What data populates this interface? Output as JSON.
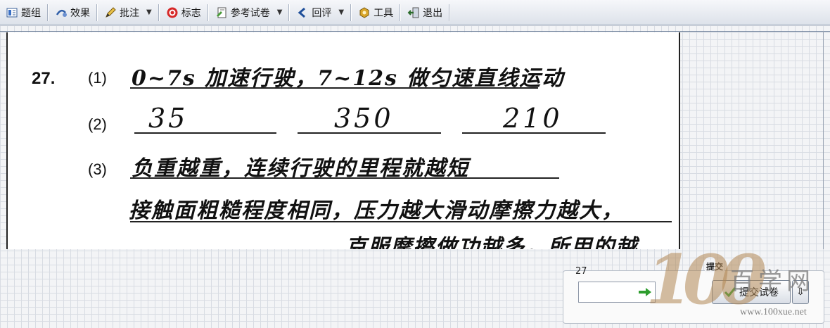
{
  "toolbar": {
    "items": [
      {
        "label": "题组",
        "icon": "question-group-icon"
      },
      {
        "label": "效果",
        "icon": "effect-icon"
      },
      {
        "label": "批注",
        "icon": "pencil-icon",
        "dropdown": true
      },
      {
        "label": "标志",
        "icon": "target-mark-icon"
      },
      {
        "label": "参考试卷",
        "icon": "reference-paper-icon",
        "dropdown": true
      },
      {
        "label": "回评",
        "icon": "back-arrow-icon",
        "dropdown": true
      },
      {
        "label": "工具",
        "icon": "tools-icon"
      },
      {
        "label": "退出",
        "icon": "exit-icon"
      }
    ]
  },
  "sheet": {
    "question_number": "27.",
    "part1_num": "(1)",
    "part1_text": "0~7s 加速行驶，7~12s 做匀速直线运动",
    "part2_num": "(2)",
    "part2_blanks": [
      "35",
      "350",
      "210"
    ],
    "part3_num": "(3)",
    "part3_line1": "负重越重，连续行驶的里程就越短",
    "part3_line2": "接触面粗糙程度相同，压力越大滑动摩擦力越大，",
    "part3_line3": "克服摩擦做功越多，所用的越"
  },
  "submit_panel": {
    "legend": "提交",
    "question_no_label": "27",
    "question_no_value": "",
    "submit_label": "提交试卷"
  },
  "watermark": {
    "digits": "100",
    "text": "百学网",
    "url": "www.100xue.net"
  },
  "colors": {
    "toolbar_top": "#f6f7fa",
    "toolbar_bottom": "#dde2ea",
    "grid_line": "#d8dce3",
    "accent_green": "#2e9d2e",
    "mark_red": "#d62828"
  }
}
